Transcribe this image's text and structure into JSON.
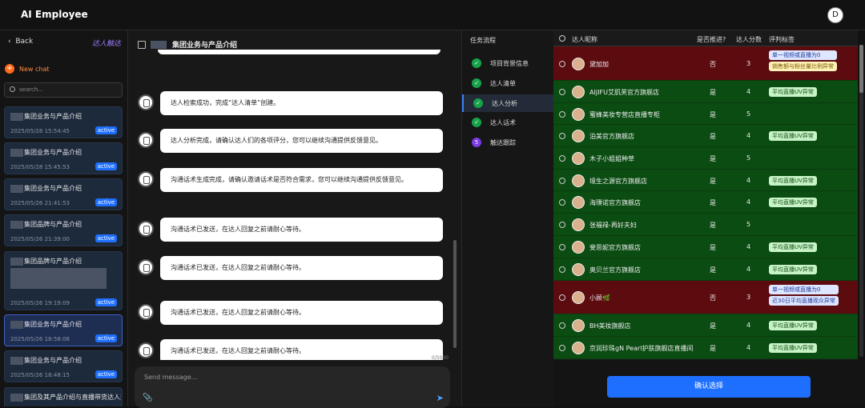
{
  "app": {
    "title": "AI Employee",
    "user_initial": "D"
  },
  "sidebar": {
    "back_label": "Back",
    "agent_label": "达人触达",
    "new_chat_label": "New chat",
    "search_placeholder": "search...",
    "sessions": [
      {
        "title": "集团业务与产品介绍",
        "date": "2025/05/28 15:54:45",
        "badge": "active"
      },
      {
        "title": "集团业务与产品介绍",
        "date": "2025/05/28 15:45:53",
        "badge": "active"
      },
      {
        "title": "集团业务与产品介绍",
        "date": "2025/05/26 21:41:53",
        "badge": "active"
      },
      {
        "title": "集团品牌与产品介绍",
        "date": "2025/05/26 21:39:00",
        "badge": "active"
      },
      {
        "title": "集团品牌与产品介绍",
        "date": "2025/05/26 19:19:09",
        "badge": "active"
      },
      {
        "title": "集团业务与产品介绍",
        "date": "2025/05/26 18:58:08",
        "badge": "active"
      },
      {
        "title": "集团业务与产品介绍",
        "date": "2025/05/26 18:48:15",
        "badge": "active"
      },
      {
        "title": "集团及其产品介绍与直播带货达人邀",
        "date": "",
        "badge": ""
      }
    ]
  },
  "chat": {
    "header_title": "集团业务与产品介绍",
    "messages": [
      "达人检索成功，完成“达人清单”创建。",
      "达人分析完成，请确认达人们的各项评分，您可以继续沟通提供反馈意见。",
      "沟通话术生成完成，请确认邀请话术是否符合需求，您可以继续沟通提供反馈意见。",
      "沟通话术已发送，在达人回复之前请耐心等待。",
      "沟通话术已发送，在达人回复之前请耐心等待。",
      "沟通话术已发送，在达人回复之前请耐心等待。",
      "沟通话术已发送，在达人回复之前请耐心等待。"
    ],
    "char_counter": "0/5000",
    "input_placeholder": "Send message..."
  },
  "tasks": {
    "title": "任务流程",
    "steps": [
      {
        "label": "项目背景信息",
        "marker": "✓"
      },
      {
        "label": "达人清单",
        "marker": "✓"
      },
      {
        "label": "达人分析",
        "marker": "✓"
      },
      {
        "label": "达人话术",
        "marker": "✓"
      },
      {
        "label": "触达跟踪",
        "marker": "5"
      }
    ]
  },
  "table": {
    "headers": {
      "name": "达人昵称",
      "pushed": "是否推进?",
      "score": "达人分数",
      "tags": "评判标签"
    },
    "rows": [
      {
        "name": "黛加加",
        "pushed": "否",
        "score": "3",
        "status": "red",
        "tags": [
          {
            "text": "单一视频或直播为0",
            "style": "blue"
          },
          {
            "text": "销售额与粉丝量比例异常",
            "style": "yellow"
          }
        ]
      },
      {
        "name": "AIJIFU艾肌芙官方旗舰店",
        "pushed": "是",
        "score": "4",
        "status": "green",
        "tags": [
          {
            "text": "平均直播UV异常",
            "style": "green"
          }
        ]
      },
      {
        "name": "蜜蜂美妆专营店直播专柜",
        "pushed": "是",
        "score": "5",
        "status": "green",
        "tags": []
      },
      {
        "name": "泊美官方旗舰店",
        "pushed": "是",
        "score": "4",
        "status": "green",
        "tags": [
          {
            "text": "平均直播UV异常",
            "style": "green"
          }
        ]
      },
      {
        "name": "木子小姐姐种草",
        "pushed": "是",
        "score": "5",
        "status": "green",
        "tags": []
      },
      {
        "name": "境生之源官方旗舰店",
        "pushed": "是",
        "score": "4",
        "status": "green",
        "tags": [
          {
            "text": "平均直播UV异常",
            "style": "green"
          }
        ]
      },
      {
        "name": "海璞诺官方旗舰店",
        "pushed": "是",
        "score": "4",
        "status": "green",
        "tags": [
          {
            "text": "平均直播UV异常",
            "style": "green"
          }
        ]
      },
      {
        "name": "张福禄-再好夫妇",
        "pushed": "是",
        "score": "5",
        "status": "green",
        "tags": []
      },
      {
        "name": "斐思妮官方旗舰店",
        "pushed": "是",
        "score": "4",
        "status": "green",
        "tags": [
          {
            "text": "平均直播UV异常",
            "style": "green"
          }
        ]
      },
      {
        "name": "奥贝兰官方旗舰店",
        "pushed": "是",
        "score": "4",
        "status": "green",
        "tags": [
          {
            "text": "平均直播UV异常",
            "style": "green"
          }
        ]
      },
      {
        "name": "小顾🌿",
        "pushed": "否",
        "score": "3",
        "status": "red",
        "tags": [
          {
            "text": "单一视频或直播为0",
            "style": "blue"
          },
          {
            "text": "近30日平均直播观众异常",
            "style": "blue"
          }
        ]
      },
      {
        "name": "BH美妆旗舰店",
        "pushed": "是",
        "score": "4",
        "status": "green",
        "tags": [
          {
            "text": "平均直播UV异常",
            "style": "green"
          }
        ]
      },
      {
        "name": "京润珍珠gN Pearl护肤旗舰店直播间",
        "pushed": "是",
        "score": "4",
        "status": "green",
        "tags": [
          {
            "text": "平均直播UV异常",
            "style": "green"
          }
        ]
      }
    ],
    "confirm_label": "确认选择"
  },
  "colors": {
    "accent": "#1f6fff",
    "green_row": "#0a4c12",
    "red_row": "#5c0b0f",
    "new_chat": "#ff8a3d",
    "agent_link": "#9b7bff"
  }
}
